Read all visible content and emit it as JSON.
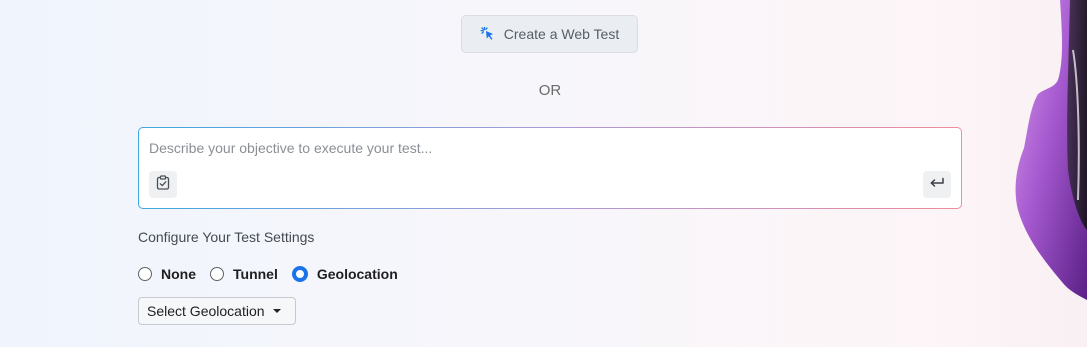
{
  "create_test": {
    "label": "Create a Web Test",
    "icon": "cursor-click-icon"
  },
  "divider_text": "OR",
  "prompt": {
    "placeholder": "Describe your objective to execute your test...",
    "value": "",
    "attach_icon": "clipboard-check-icon",
    "submit_icon": "enter-return-icon"
  },
  "settings": {
    "title": "Configure Your Test Settings",
    "options": [
      {
        "label": "None",
        "checked": false
      },
      {
        "label": "Tunnel",
        "checked": false
      },
      {
        "label": "Geolocation",
        "checked": true
      }
    ],
    "geolocation_select": {
      "label": "Select Geolocation",
      "icon": "caret-down-icon"
    }
  },
  "colors": {
    "accent": "#1a73e8",
    "gradient_start": "#3ea8e0",
    "gradient_end": "#f08c9c",
    "mascot": "#8a3fc0"
  }
}
